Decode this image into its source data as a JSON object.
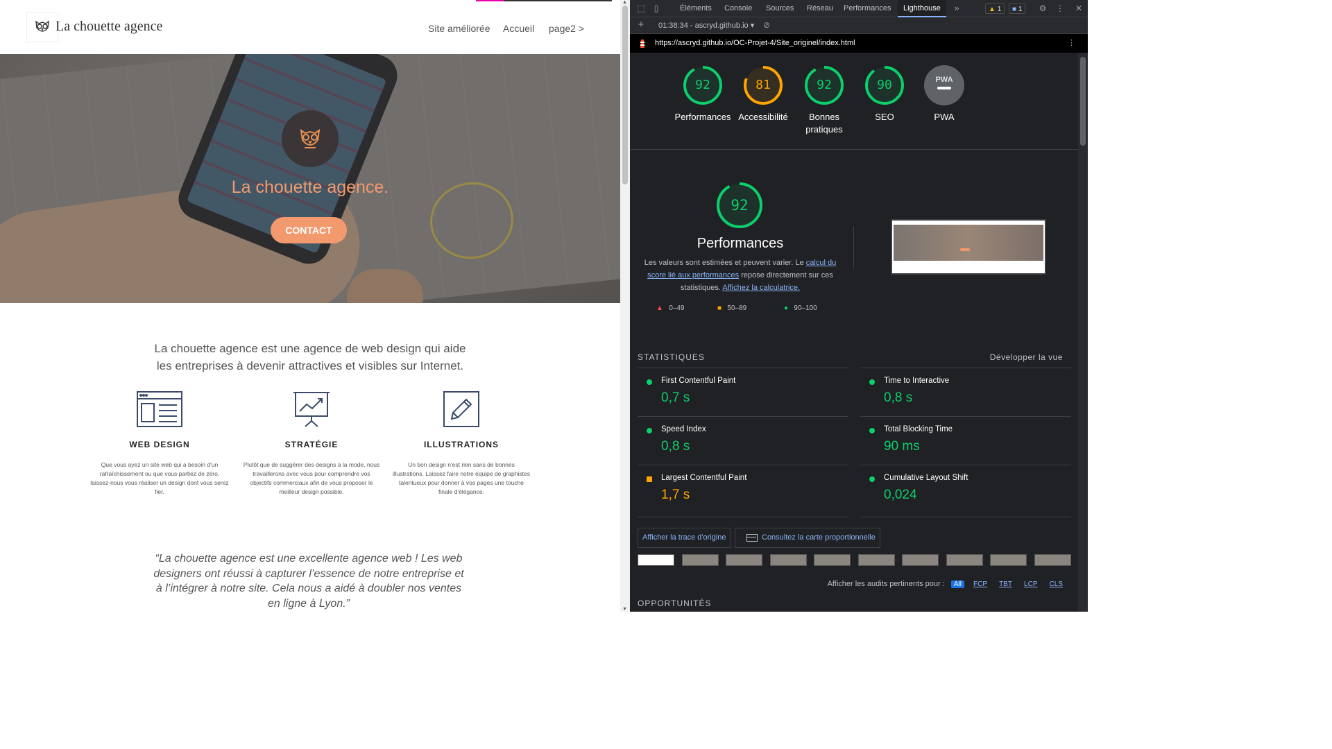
{
  "site": {
    "logo_text": "La chouette agence",
    "nav": [
      "Site améliorée",
      "Accueil",
      "page2 >"
    ],
    "hero_title": "La chouette agence.",
    "contact_label": "CONTACT",
    "tagline_1": "La chouette agence est une agence de web design qui aide",
    "tagline_2": "les entreprises à devenir attractives et visibles sur Internet.",
    "services": [
      {
        "title": "WEB DESIGN",
        "text": "Que vous ayez un site web qui a besoin d'un rafraîchissement ou que vous partiez de zéro, laissez-nous vous réaliser un design dont vous serez fier."
      },
      {
        "title": "STRATÉGIE",
        "text": "Plutôt que de suggérer des designs à la mode, nous travaillerons avec vous pour comprendre vos objectifs commerciaux afin de vous proposer le meilleur design possible."
      },
      {
        "title": "ILLUSTRATIONS",
        "text": "Un bon design n'est rien sans de bonnes illustrations. Laissez faire notre équipe de graphistes talentueux pour donner à vos pages une touche finale d'élégance."
      }
    ],
    "quote": "“La chouette agence est une excellente agence web ! Les web designers ont réussi à capturer l’essence de notre entreprise et à l’intégrer à notre site. Cela nous a aidé à doubler nos ventes en ligne à Lyon.”"
  },
  "devtools": {
    "tabs": [
      "Éléments",
      "Console",
      "Sources",
      "Réseau",
      "Performances",
      "Lighthouse"
    ],
    "more_tabs": "»",
    "warn_count": "1",
    "msg_count": "1",
    "report_time": "01:38:34 - ascryd.github.io",
    "url": "https://ascryd.github.io/OC-Projet-4/Site_originel/index.html",
    "scores": [
      {
        "value": "92",
        "label": "Performances",
        "color": "#0cce6b",
        "fraction": 0.92
      },
      {
        "value": "81",
        "label": "Accessibilité",
        "color": "#ffa400",
        "fraction": 0.81
      },
      {
        "value": "92",
        "label": "Bonnes pratiques",
        "color": "#0cce6b",
        "fraction": 0.92
      },
      {
        "value": "90",
        "label": "SEO",
        "color": "#0cce6b",
        "fraction": 0.9
      },
      {
        "value": "PWA",
        "label": "PWA",
        "color": "#9aa0a6",
        "fraction": 0
      }
    ],
    "perf": {
      "score": "92",
      "title": "Performances",
      "desc_1": "Les valeurs sont estimées et peuvent varier. Le ",
      "desc_link_1": "calcul du score lié aux performances",
      "desc_2": " repose directement sur ces statistiques. ",
      "desc_link_2": "Affichez la calculatrice."
    },
    "legend": {
      "low": "0–49",
      "mid": "50–89",
      "high": "90–100"
    },
    "stats_title": "STATISTIQUES",
    "expand_view": "Développer la vue",
    "metrics": [
      {
        "name": "First Contentful Paint",
        "value": "0,7 s",
        "status": "good"
      },
      {
        "name": "Time to Interactive",
        "value": "0,8 s",
        "status": "good"
      },
      {
        "name": "Speed Index",
        "value": "0,8 s",
        "status": "good"
      },
      {
        "name": "Total Blocking Time",
        "value": "90 ms",
        "status": "good"
      },
      {
        "name": "Largest Contentful Paint",
        "value": "1,7 s",
        "status": "average"
      },
      {
        "name": "Cumulative Layout Shift",
        "value": "0,024",
        "status": "good"
      }
    ],
    "trace_button": "Afficher la trace d'origine",
    "treemap_button": "Consultez la carte proportionnelle",
    "filter_label": "Afficher les audits pertinents pour :",
    "filter_chips": [
      "All",
      "FCP",
      "TBT",
      "LCP",
      "CLS"
    ],
    "opportunities_title": "OPPORTUNITÉS"
  },
  "colors": {
    "good": "#0cce6b",
    "average": "#ffa400",
    "poor": "#ff4e42",
    "accent": "#f29a6e"
  }
}
